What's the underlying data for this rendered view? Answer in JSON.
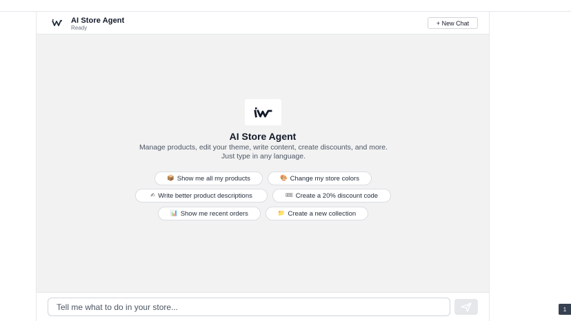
{
  "header": {
    "title": "AI Store Agent",
    "status": "Ready",
    "new_chat_label": "+ New Chat",
    "logo_icon": "iw-logo-icon"
  },
  "hero": {
    "title": "AI Store Agent",
    "description": "Manage products, edit your theme, write content, create discounts, and more. Just type in any language.",
    "logo_icon": "iw-logo-icon"
  },
  "suggestions": [
    {
      "icon": "box-icon",
      "glyph": "📦",
      "label": "Show me all my products"
    },
    {
      "icon": "palette-icon",
      "glyph": "🎨",
      "label": "Change my store colors"
    },
    {
      "icon": "pen-icon",
      "glyph": "✍",
      "label": "Write better product descriptions"
    },
    {
      "icon": "ticket-icon",
      "glyph": "🎟",
      "label": "Create a 20% discount code"
    },
    {
      "icon": "chart-icon",
      "glyph": "📊",
      "label": "Show me recent orders"
    },
    {
      "icon": "folder-icon",
      "glyph": "📁",
      "label": "Create a new collection"
    }
  ],
  "composer": {
    "placeholder": "Tell me what to do in your store...",
    "send_icon": "send-icon"
  },
  "corner_tab": {
    "label": "1"
  },
  "colors": {
    "panel_bg": "#f2f2f2",
    "text_primary": "#111827",
    "text_secondary": "#4b5563",
    "border": "#d9dde2"
  }
}
